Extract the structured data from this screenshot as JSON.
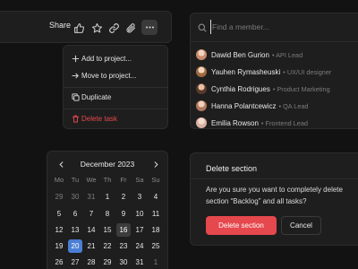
{
  "toolbar": {
    "share_label": "Share",
    "icons": [
      "thumbs-up-icon",
      "star-icon",
      "link-icon",
      "paperclip-icon",
      "more-icon"
    ]
  },
  "menu": {
    "items": [
      {
        "label": "Add to project...",
        "icon": "plus-icon"
      },
      {
        "label": "Move to project...",
        "icon": "arrow-right-icon"
      },
      {
        "label": "Duplicate",
        "icon": "copy-icon"
      },
      {
        "label": "Delete task",
        "icon": "trash-icon",
        "color": "#e5484d"
      }
    ]
  },
  "members": {
    "search_placeholder": "Find a member...",
    "list": [
      {
        "name": "Dawid Ben Gurion",
        "role": "API Lead",
        "avatar_color": "#c98b6b"
      },
      {
        "name": "Yauhen Rymasheuski",
        "role": "UX/UI designer",
        "avatar_color": "#d1a17a"
      },
      {
        "name": "Cynthia Rodrigues",
        "role": "Product Marketing",
        "avatar_color": "#b5856a"
      },
      {
        "name": "Hanna Polantcewicz",
        "role": "QA Lead",
        "avatar_color": "#c68f7e"
      },
      {
        "name": "Emilia Rowson",
        "role": "Frontend Lead",
        "avatar_color": "#d9b3a3"
      }
    ]
  },
  "calendar": {
    "title": "December 2023",
    "weekdays": [
      "Mo",
      "Tu",
      "We",
      "Th",
      "Fr",
      "Sa",
      "Su"
    ],
    "rows": [
      [
        "29",
        "30",
        "31",
        "1",
        "2",
        "3",
        "4"
      ],
      [
        "5",
        "6",
        "7",
        "8",
        "9",
        "10",
        "11"
      ],
      [
        "12",
        "13",
        "14",
        "15",
        "16",
        "17",
        "18"
      ],
      [
        "19",
        "20",
        "21",
        "22",
        "23",
        "24",
        "25"
      ],
      [
        "26",
        "27",
        "28",
        "29",
        "30",
        "31",
        "1"
      ]
    ],
    "selected_day": "20",
    "highlighted_day": "16",
    "accent": "#4a7fd4"
  },
  "dialog": {
    "title": "Delete section",
    "message": "Are you sure you want to completely delete section “Backlog” and all tasks?",
    "confirm_label": "Delete section",
    "cancel_label": "Cancel",
    "danger_color": "#e5484d"
  }
}
